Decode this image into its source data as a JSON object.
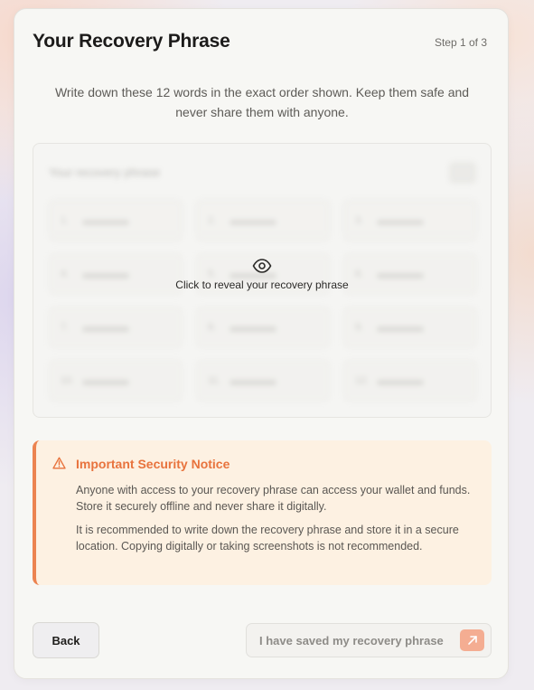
{
  "header": {
    "title": "Your Recovery Phrase",
    "step": "Step 1 of 3"
  },
  "intro": "Write down these 12 words in the exact order shown. Keep them safe and never share them with anyone.",
  "phrase": {
    "label": "Your recovery phrase",
    "reveal_text": "Click to reveal your recovery phrase",
    "word_numbers": [
      "1.",
      "2.",
      "3.",
      "4.",
      "5.",
      "6.",
      "7.",
      "8.",
      "9.",
      "10.",
      "11.",
      "12."
    ]
  },
  "notice": {
    "title": "Important Security Notice",
    "paragraph1": "Anyone with access to your recovery phrase can access your wallet and funds. Store it securely offline and never share it digitally.",
    "paragraph2": "It is recommended to write down the recovery phrase and store it in a secure location. Copying digitally or taking screenshots is not recommended.",
    "accent_color": "#ec8350"
  },
  "actions": {
    "back_label": "Back",
    "confirm_label": "I have saved my recovery phrase"
  },
  "icons": {
    "reveal": "eye-icon",
    "warning": "warning-triangle-icon",
    "confirm": "arrow-up-right-icon",
    "copy": "copy-icon"
  }
}
